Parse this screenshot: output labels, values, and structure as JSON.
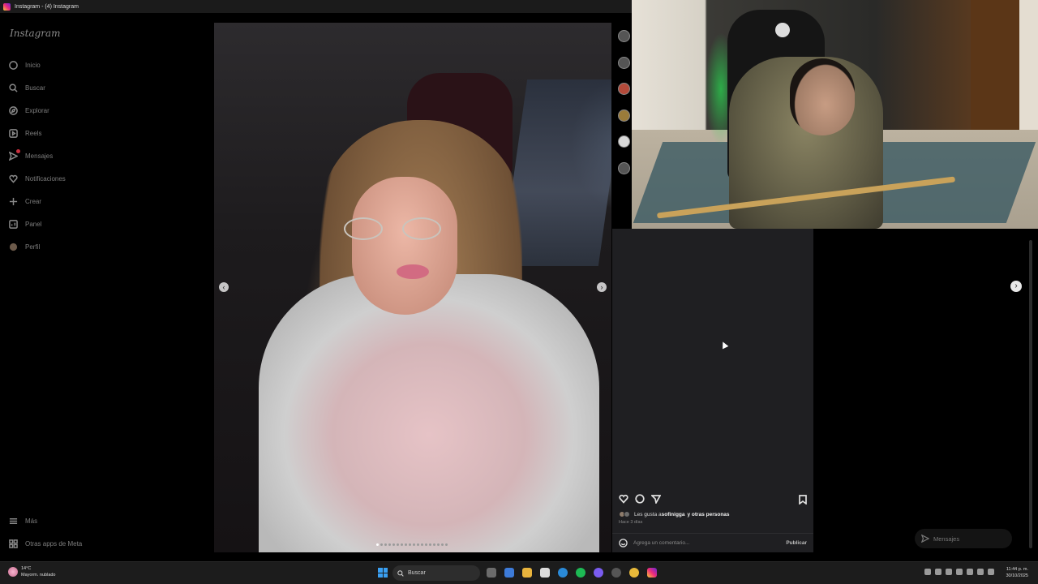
{
  "window": {
    "title": "Instagram - (4) Instagram"
  },
  "sidebar": {
    "logo": "Instagram",
    "items": [
      {
        "label": "Inicio",
        "icon": "home-icon"
      },
      {
        "label": "Buscar",
        "icon": "search-icon"
      },
      {
        "label": "Explorar",
        "icon": "compass-icon"
      },
      {
        "label": "Reels",
        "icon": "reels-icon"
      },
      {
        "label": "Mensajes",
        "icon": "messenger-icon"
      },
      {
        "label": "Notificaciones",
        "icon": "heart-icon"
      },
      {
        "label": "Crear",
        "icon": "plus-icon"
      },
      {
        "label": "Panel",
        "icon": "chart-icon"
      },
      {
        "label": "Perfil",
        "icon": "avatar-icon"
      }
    ],
    "more": "Más",
    "meta_apps": "Otras apps de Meta"
  },
  "post": {
    "carousel_total": 18,
    "carousel_active": 1,
    "likes_prefix": "Les gusta a ",
    "liked_by": "sofiniggа",
    "likes_suffix": "y otras personas",
    "time_ago": "Hace 3 días",
    "comment_placeholder": "Agrega un comentario...",
    "publish": "Publicar"
  },
  "messages_pill": {
    "label": "Mensajes"
  },
  "taskbar": {
    "weather_temp": "14°C",
    "weather_desc": "Mayorm. nublado",
    "search_label": "Buscar",
    "time": "11:44 p. m.",
    "date": "30/10/2025"
  },
  "colors": {
    "background": "#000000",
    "panel": "#1f1f22",
    "accent_blue": "#3aa0f3",
    "notification_red": "#c9303e"
  }
}
